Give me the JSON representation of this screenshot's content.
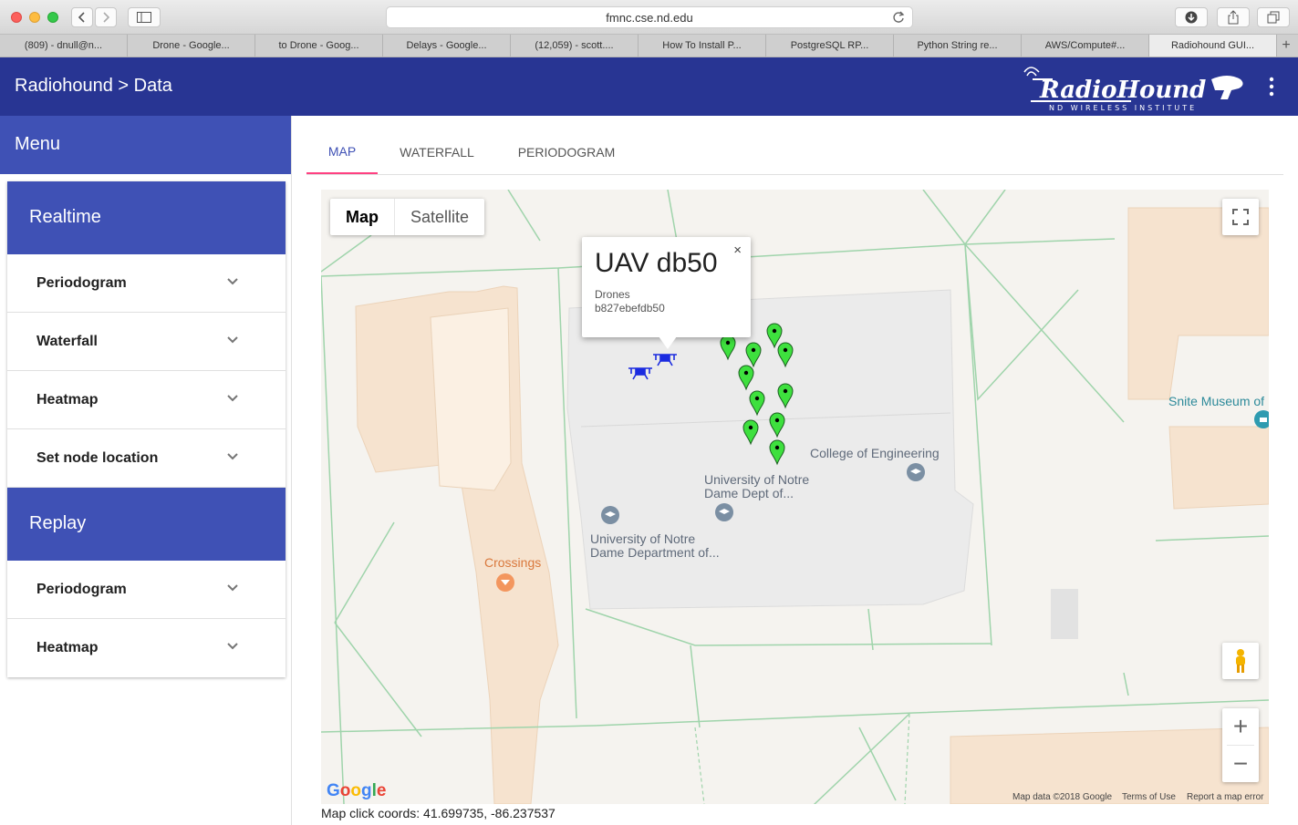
{
  "browser": {
    "url": "fmnc.cse.nd.edu",
    "tabs": [
      "(809) - dnull@n...",
      "Drone - Google...",
      "to Drone - Goog...",
      "Delays - Google...",
      "(12,059) - scott....",
      "How To Install P...",
      "PostgreSQL RP...",
      "Python String re...",
      "AWS/Compute#...",
      "Radiohound GUI..."
    ],
    "active_tab": 9
  },
  "app": {
    "title": "Radiohound > Data",
    "logo_text": "RadioHound",
    "logo_subtext": "ND WIRELESS INSTITUTE"
  },
  "sidebar": {
    "menu_label": "Menu",
    "sections": [
      {
        "title": "Realtime",
        "items": [
          "Periodogram",
          "Waterfall",
          "Heatmap",
          "Set node location"
        ]
      },
      {
        "title": "Replay",
        "items": [
          "Periodogram",
          "Heatmap"
        ]
      }
    ]
  },
  "main": {
    "tabs": [
      "MAP",
      "WATERFALL",
      "PERIODOGRAM"
    ],
    "active_tab": "MAP"
  },
  "map": {
    "type_options": [
      "Map",
      "Satellite"
    ],
    "selected_type": "Map",
    "labels": {
      "college": "College of Engineering",
      "dept1_line1": "University of Notre",
      "dept1_line2": "Dame Dept of...",
      "dept2_line1": "University of Notre",
      "dept2_line2": "Dame Department of...",
      "crossings": "Crossings",
      "museum": "Snite Museum of"
    },
    "info_window": {
      "title": "UAV db50",
      "category": "Drones",
      "id": "b827ebefdb50",
      "close": "×"
    },
    "attribution": {
      "google": "Google",
      "map_data": "Map data ©2018 Google",
      "terms": "Terms of Use",
      "report": "Report a map error"
    },
    "zoom_in": "+",
    "zoom_out": "−",
    "marker_color": "#3ee03e",
    "drone_color": "#1a2be0"
  },
  "footer": {
    "coords": "Map click coords: 41.699735, -86.237537"
  }
}
